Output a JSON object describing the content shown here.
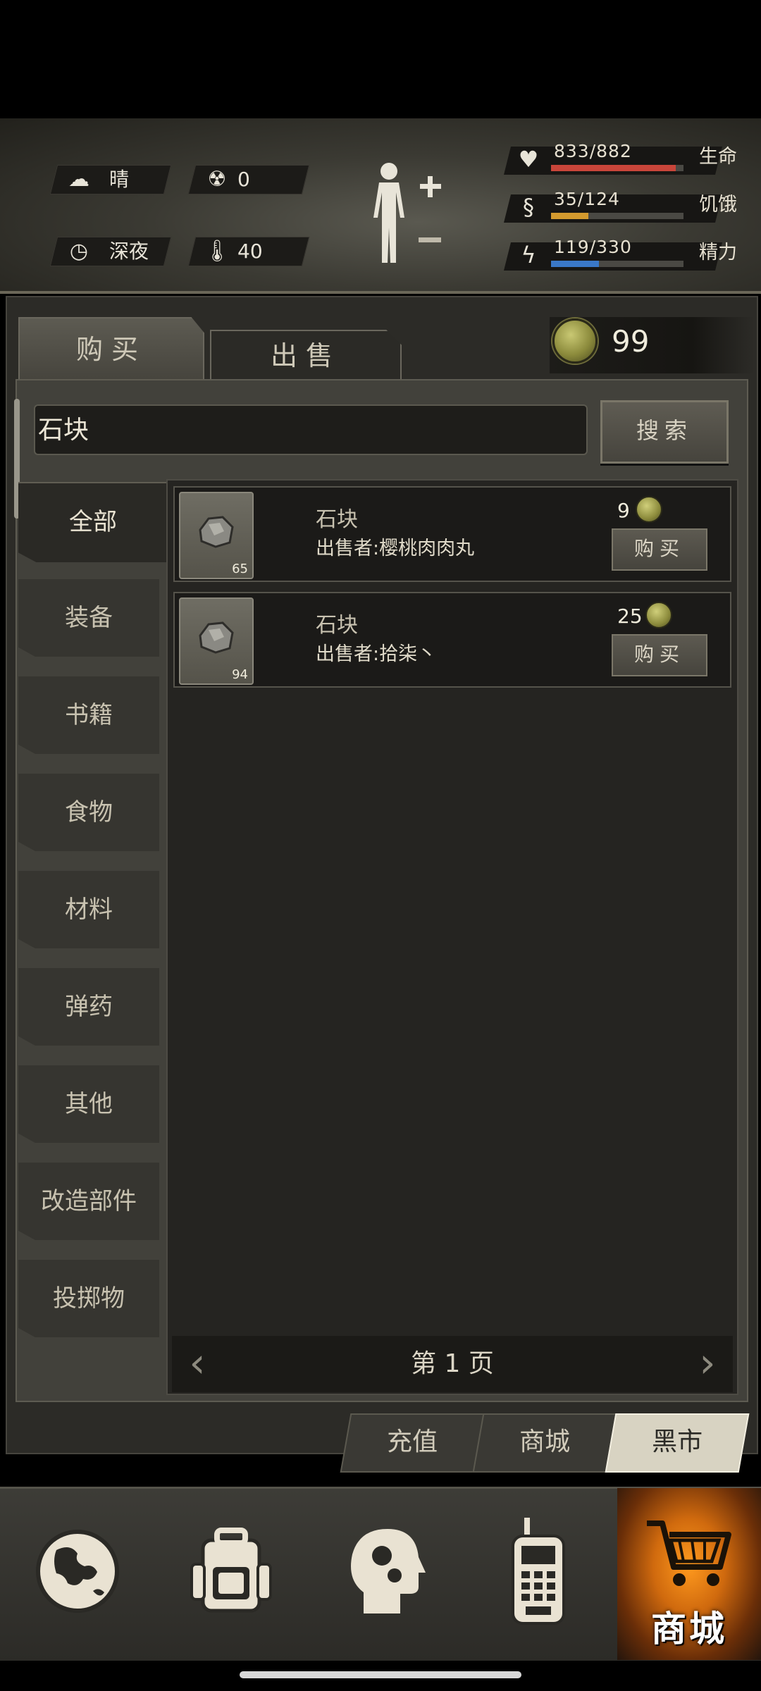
{
  "status": {
    "weather": {
      "icon": "cloud-sun-icon",
      "value": "晴"
    },
    "radiation": {
      "icon": "radiation-icon",
      "value": "0"
    },
    "time": {
      "icon": "clock-icon",
      "value": "深夜"
    },
    "temperature": {
      "icon": "thermometer-icon",
      "value": "40"
    },
    "health": {
      "value": "833/882",
      "label": "生命",
      "fill": 0.944,
      "color": "#c8453a"
    },
    "hunger": {
      "value": "35/124",
      "label": "饥饿",
      "fill": 0.282,
      "color": "#d49a2e"
    },
    "energy": {
      "value": "119/330",
      "label": "精力",
      "fill": 0.36,
      "color": "#3a78c8"
    }
  },
  "shop": {
    "tabs": {
      "buy": "购买",
      "sell": "出售"
    },
    "coins": "99",
    "search": {
      "value": "石块",
      "button": "搜索"
    },
    "categories": [
      "全部",
      "装备",
      "书籍",
      "食物",
      "材料",
      "弹药",
      "其他",
      "改造部件",
      "投掷物"
    ],
    "items": [
      {
        "name": "石块",
        "seller": "出售者:樱桃肉肉丸",
        "count": "65",
        "price": "9",
        "buy": "购买"
      },
      {
        "name": "石块",
        "seller": "出售者:拾柒丶",
        "count": "94",
        "price": "25",
        "buy": "购买"
      }
    ],
    "pager": "第 1 页"
  },
  "market": {
    "recharge": "充值",
    "store": "商城",
    "black_market": "黑市"
  },
  "nav": {
    "shop_label": "商城"
  }
}
